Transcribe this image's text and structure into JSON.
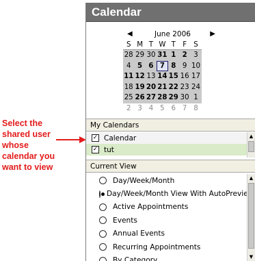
{
  "annotation": {
    "lines": [
      "Select the",
      "shared user",
      "whose",
      "calendar you",
      "want to view"
    ]
  },
  "panel": {
    "title": "Calendar"
  },
  "mini_calendar": {
    "month_label": "June 2006",
    "prev_icon": "left-triangle",
    "next_icon": "right-triangle",
    "weekday_headers": [
      "S",
      "M",
      "T",
      "W",
      "T",
      "F",
      "S"
    ],
    "weeks": [
      [
        {
          "d": "28",
          "in": true
        },
        {
          "d": "29",
          "in": true
        },
        {
          "d": "30",
          "in": true
        },
        {
          "d": "31",
          "in": true,
          "b": true
        },
        {
          "d": "1",
          "in": true,
          "b": true
        },
        {
          "d": "2",
          "in": true,
          "b": true
        },
        {
          "d": "3",
          "in": true
        }
      ],
      [
        {
          "d": "4",
          "in": true
        },
        {
          "d": "5",
          "in": true,
          "b": true
        },
        {
          "d": "6",
          "in": true,
          "b": true
        },
        {
          "d": "7",
          "in": true,
          "b": true,
          "sel": true
        },
        {
          "d": "8",
          "in": true,
          "b": true
        },
        {
          "d": "9",
          "in": true
        },
        {
          "d": "10",
          "in": true
        }
      ],
      [
        {
          "d": "11",
          "in": true,
          "b": true
        },
        {
          "d": "12",
          "in": true,
          "b": true
        },
        {
          "d": "13",
          "in": true
        },
        {
          "d": "14",
          "in": true,
          "b": true
        },
        {
          "d": "15",
          "in": true,
          "b": true
        },
        {
          "d": "16",
          "in": true
        },
        {
          "d": "17",
          "in": true
        }
      ],
      [
        {
          "d": "18",
          "in": true
        },
        {
          "d": "19",
          "in": true,
          "b": true
        },
        {
          "d": "20",
          "in": true,
          "b": true
        },
        {
          "d": "21",
          "in": true,
          "b": true
        },
        {
          "d": "22",
          "in": true,
          "b": true
        },
        {
          "d": "23",
          "in": true
        },
        {
          "d": "24",
          "in": true
        }
      ],
      [
        {
          "d": "25",
          "in": true
        },
        {
          "d": "26",
          "in": true,
          "b": true
        },
        {
          "d": "27",
          "in": true,
          "b": true
        },
        {
          "d": "28",
          "in": true,
          "b": true
        },
        {
          "d": "29",
          "in": true,
          "b": true
        },
        {
          "d": "30",
          "in": true
        },
        {
          "d": "1",
          "in": true
        }
      ],
      [
        {
          "d": "2",
          "grey": true
        },
        {
          "d": "3",
          "grey": true
        },
        {
          "d": "4",
          "grey": true
        },
        {
          "d": "5",
          "grey": true
        },
        {
          "d": "6",
          "grey": true
        },
        {
          "d": "7",
          "grey": true
        },
        {
          "d": "8",
          "grey": true
        }
      ]
    ]
  },
  "my_calendars": {
    "header": "My Calendars",
    "items": [
      {
        "label": "Calendar",
        "checked": true,
        "highlight": "#f3f3f3"
      },
      {
        "label": "tut",
        "checked": true,
        "highlight": "#d9ebc8"
      }
    ]
  },
  "current_view": {
    "header": "Current View",
    "options": [
      {
        "label": "Day/Week/Month",
        "selected": false
      },
      {
        "label": "Day/Week/Month View With AutoPreview",
        "selected": true
      },
      {
        "label": "Active Appointments",
        "selected": false
      },
      {
        "label": "Events",
        "selected": false
      },
      {
        "label": "Annual Events",
        "selected": false
      },
      {
        "label": "Recurring Appointments",
        "selected": false
      },
      {
        "label": "By Category",
        "selected": false
      }
    ]
  },
  "colors": {
    "annotation_red": "#e31b1b",
    "header_bg": "#707070",
    "calendar_highlight": "#d9ebc8"
  }
}
